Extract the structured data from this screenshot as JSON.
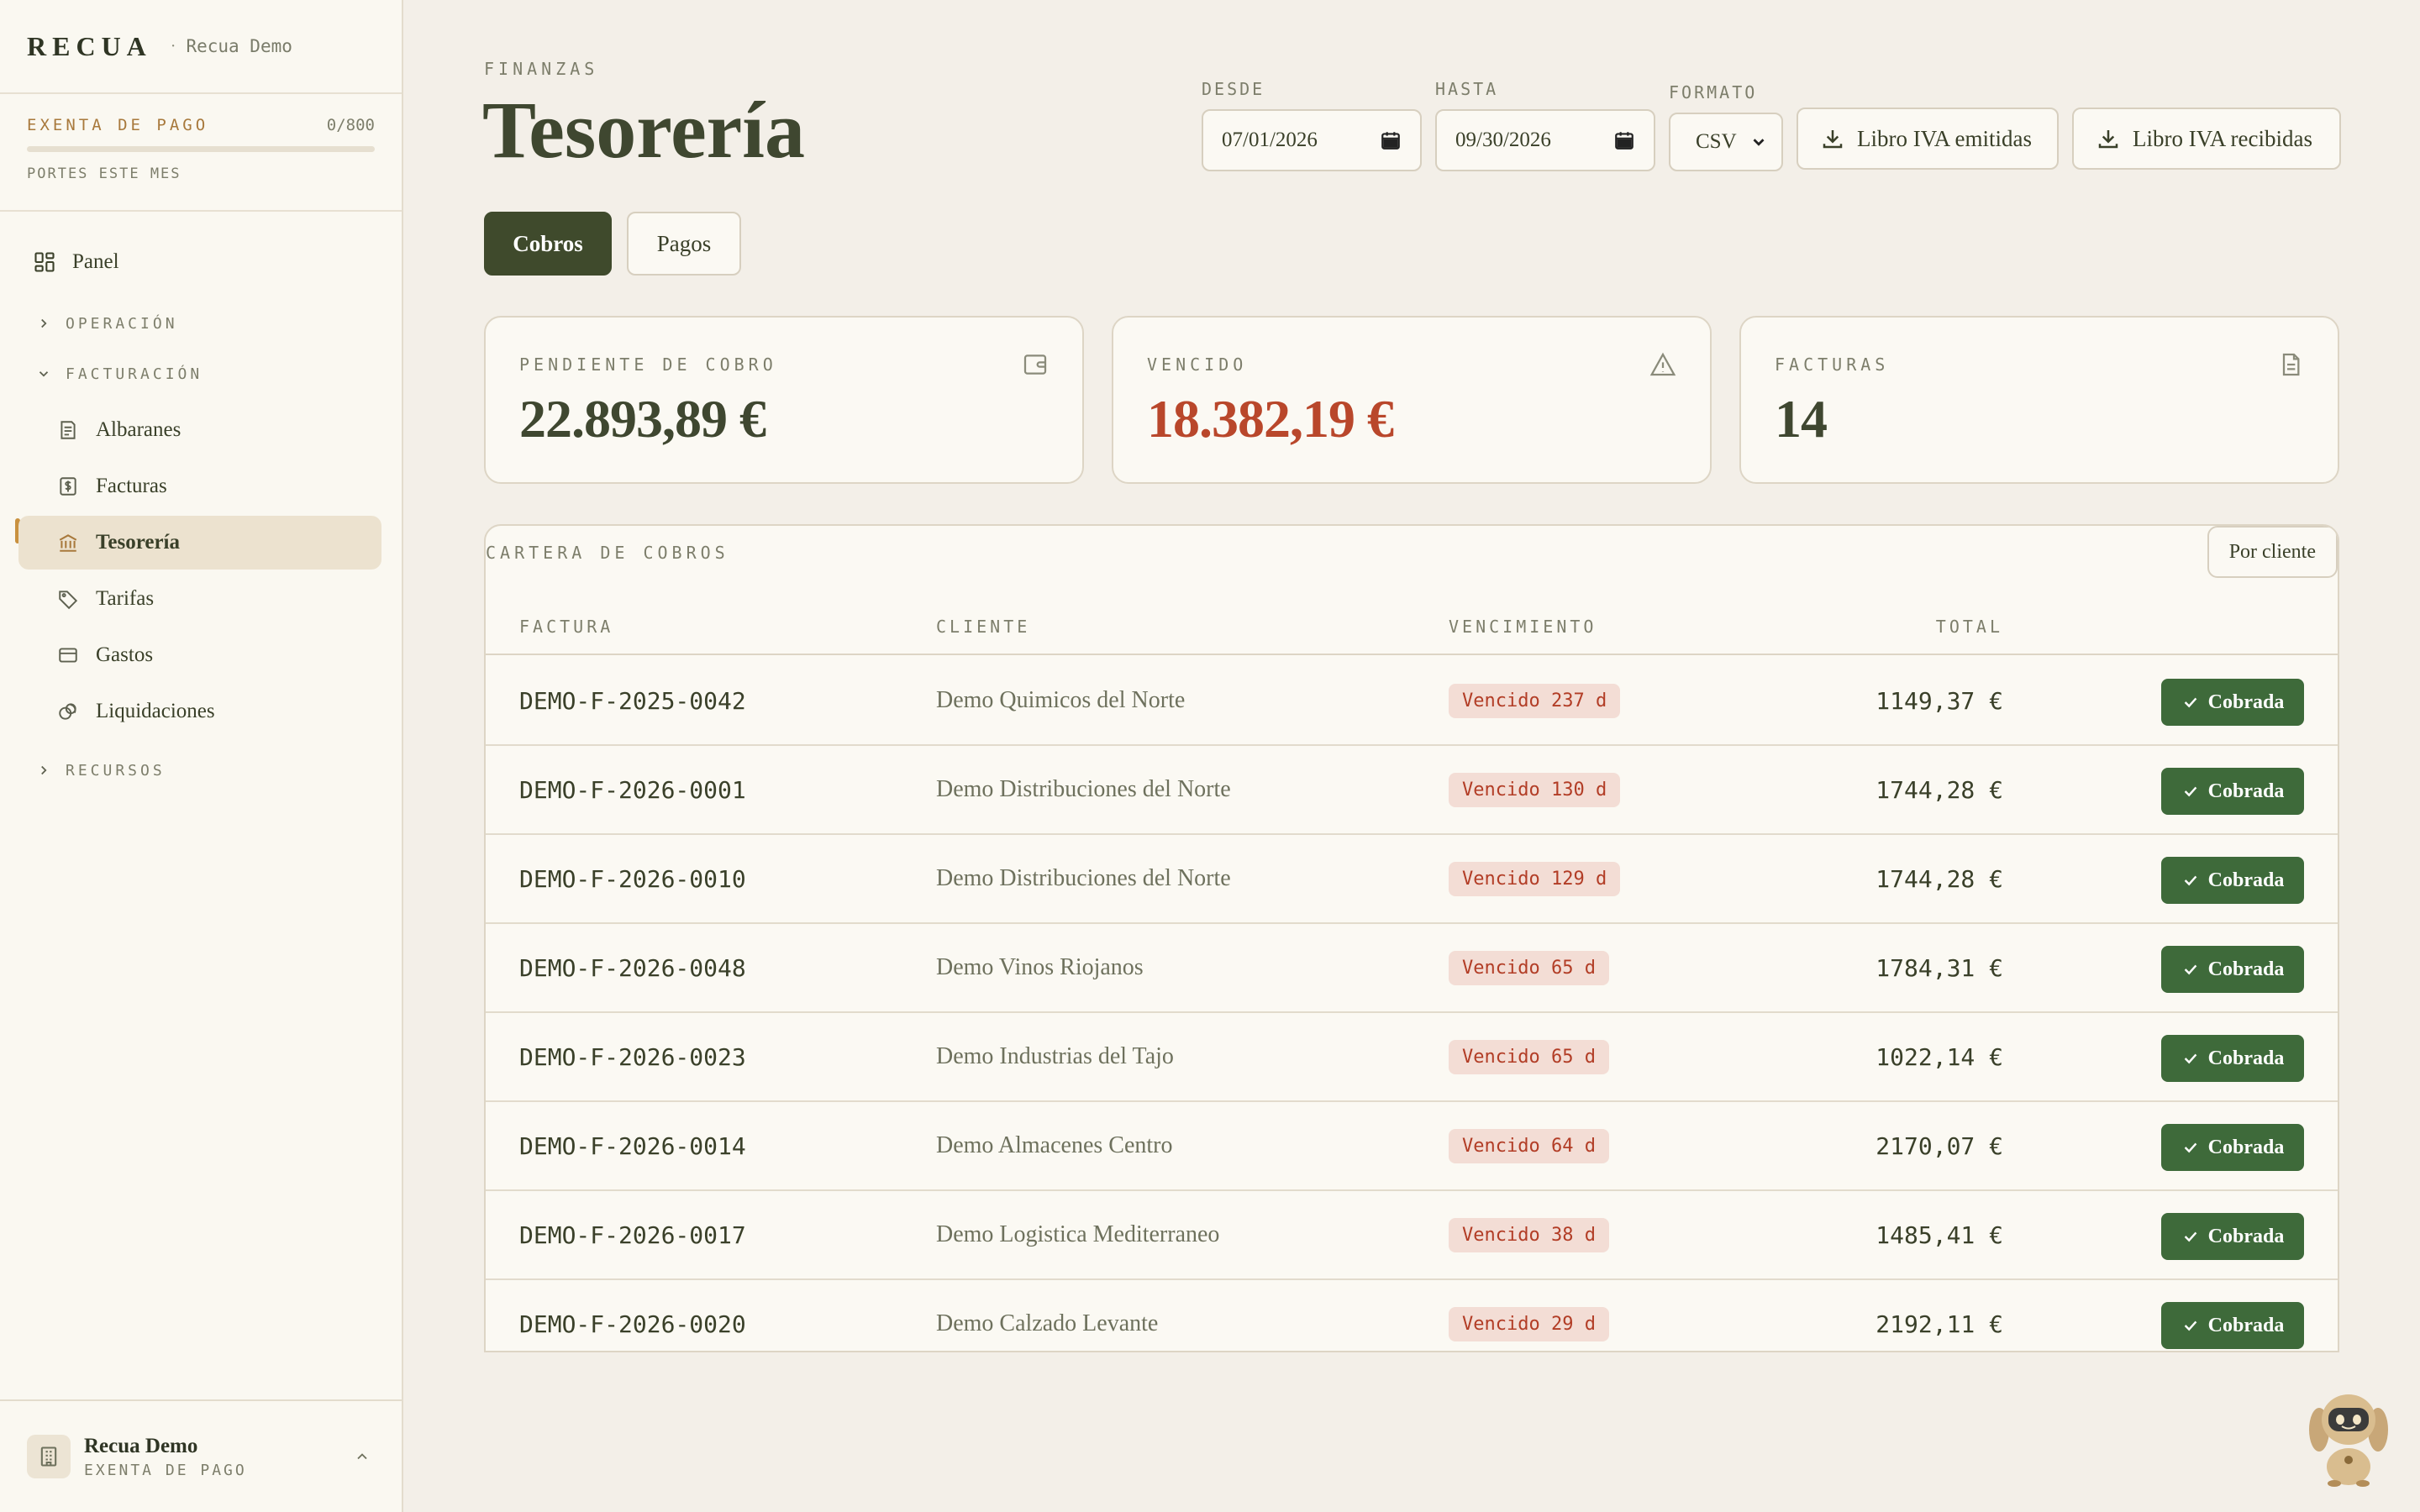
{
  "brand": {
    "logo": "RECUA",
    "separator": "·",
    "org": "Recua Demo"
  },
  "quota": {
    "label": "EXENTA DE PAGO",
    "count": "0/800",
    "progress": 0.0,
    "note": "PORTES ESTE MES"
  },
  "nav": {
    "panel": "Panel",
    "group_operacion": "OPERACIÓN",
    "group_facturacion": "FACTURACIÓN",
    "albaranes": "Albaranes",
    "facturas": "Facturas",
    "tesoreria": "Tesorería",
    "tarifas": "Tarifas",
    "gastos": "Gastos",
    "liquidaciones": "Liquidaciones",
    "group_recursos": "RECURSOS"
  },
  "account": {
    "name": "Recua Demo",
    "plan": "EXENTA DE PAGO"
  },
  "header": {
    "eyebrow": "FINANZAS",
    "title": "Tesorería"
  },
  "filters": {
    "desde_label": "DESDE",
    "desde_value": "07/01/2026",
    "hasta_label": "HASTA",
    "hasta_value": "09/30/2026",
    "formato_label": "FORMATO",
    "formato_value": "CSV",
    "btn_emitidas": "Libro IVA emitidas",
    "btn_recibidas": "Libro IVA recibidas"
  },
  "tabs": {
    "cobros": "Cobros",
    "pagos": "Pagos"
  },
  "cards": {
    "pendiente_label": "PENDIENTE DE COBRO",
    "pendiente_value": "22.893,89 €",
    "vencido_label": "VENCIDO",
    "vencido_value": "18.382,19 €",
    "facturas_label": "FACTURAS",
    "facturas_value": "14"
  },
  "table": {
    "title": "CARTERA DE COBROS",
    "group_button": "Por cliente",
    "headers": {
      "factura": "FACTURA",
      "cliente": "CLIENTE",
      "vencimiento": "VENCIMIENTO",
      "total": "TOTAL"
    },
    "action_label": "Cobrada",
    "rows": [
      {
        "factura": "DEMO-F-2025-0042",
        "cliente": "Demo Quimicos del Norte",
        "vencimiento": "Vencido 237 d",
        "total": "1149,37 €"
      },
      {
        "factura": "DEMO-F-2026-0001",
        "cliente": "Demo Distribuciones del Norte",
        "vencimiento": "Vencido 130 d",
        "total": "1744,28 €"
      },
      {
        "factura": "DEMO-F-2026-0010",
        "cliente": "Demo Distribuciones del Norte",
        "vencimiento": "Vencido 129 d",
        "total": "1744,28 €"
      },
      {
        "factura": "DEMO-F-2026-0048",
        "cliente": "Demo Vinos Riojanos",
        "vencimiento": "Vencido 65 d",
        "total": "1784,31 €"
      },
      {
        "factura": "DEMO-F-2026-0023",
        "cliente": "Demo Industrias del Tajo",
        "vencimiento": "Vencido 65 d",
        "total": "1022,14 €"
      },
      {
        "factura": "DEMO-F-2026-0014",
        "cliente": "Demo Almacenes Centro",
        "vencimiento": "Vencido 64 d",
        "total": "2170,07 €"
      },
      {
        "factura": "DEMO-F-2026-0017",
        "cliente": "Demo Logistica Mediterraneo",
        "vencimiento": "Vencido 38 d",
        "total": "1485,41 €"
      },
      {
        "factura": "DEMO-F-2026-0020",
        "cliente": "Demo Calzado Levante",
        "vencimiento": "Vencido 29 d",
        "total": "2192,11 €"
      }
    ]
  },
  "colors": {
    "accent": "#3f4a2c",
    "overdue": "#b9472b",
    "success": "#3e6a3a",
    "gold": "#a8793c"
  }
}
